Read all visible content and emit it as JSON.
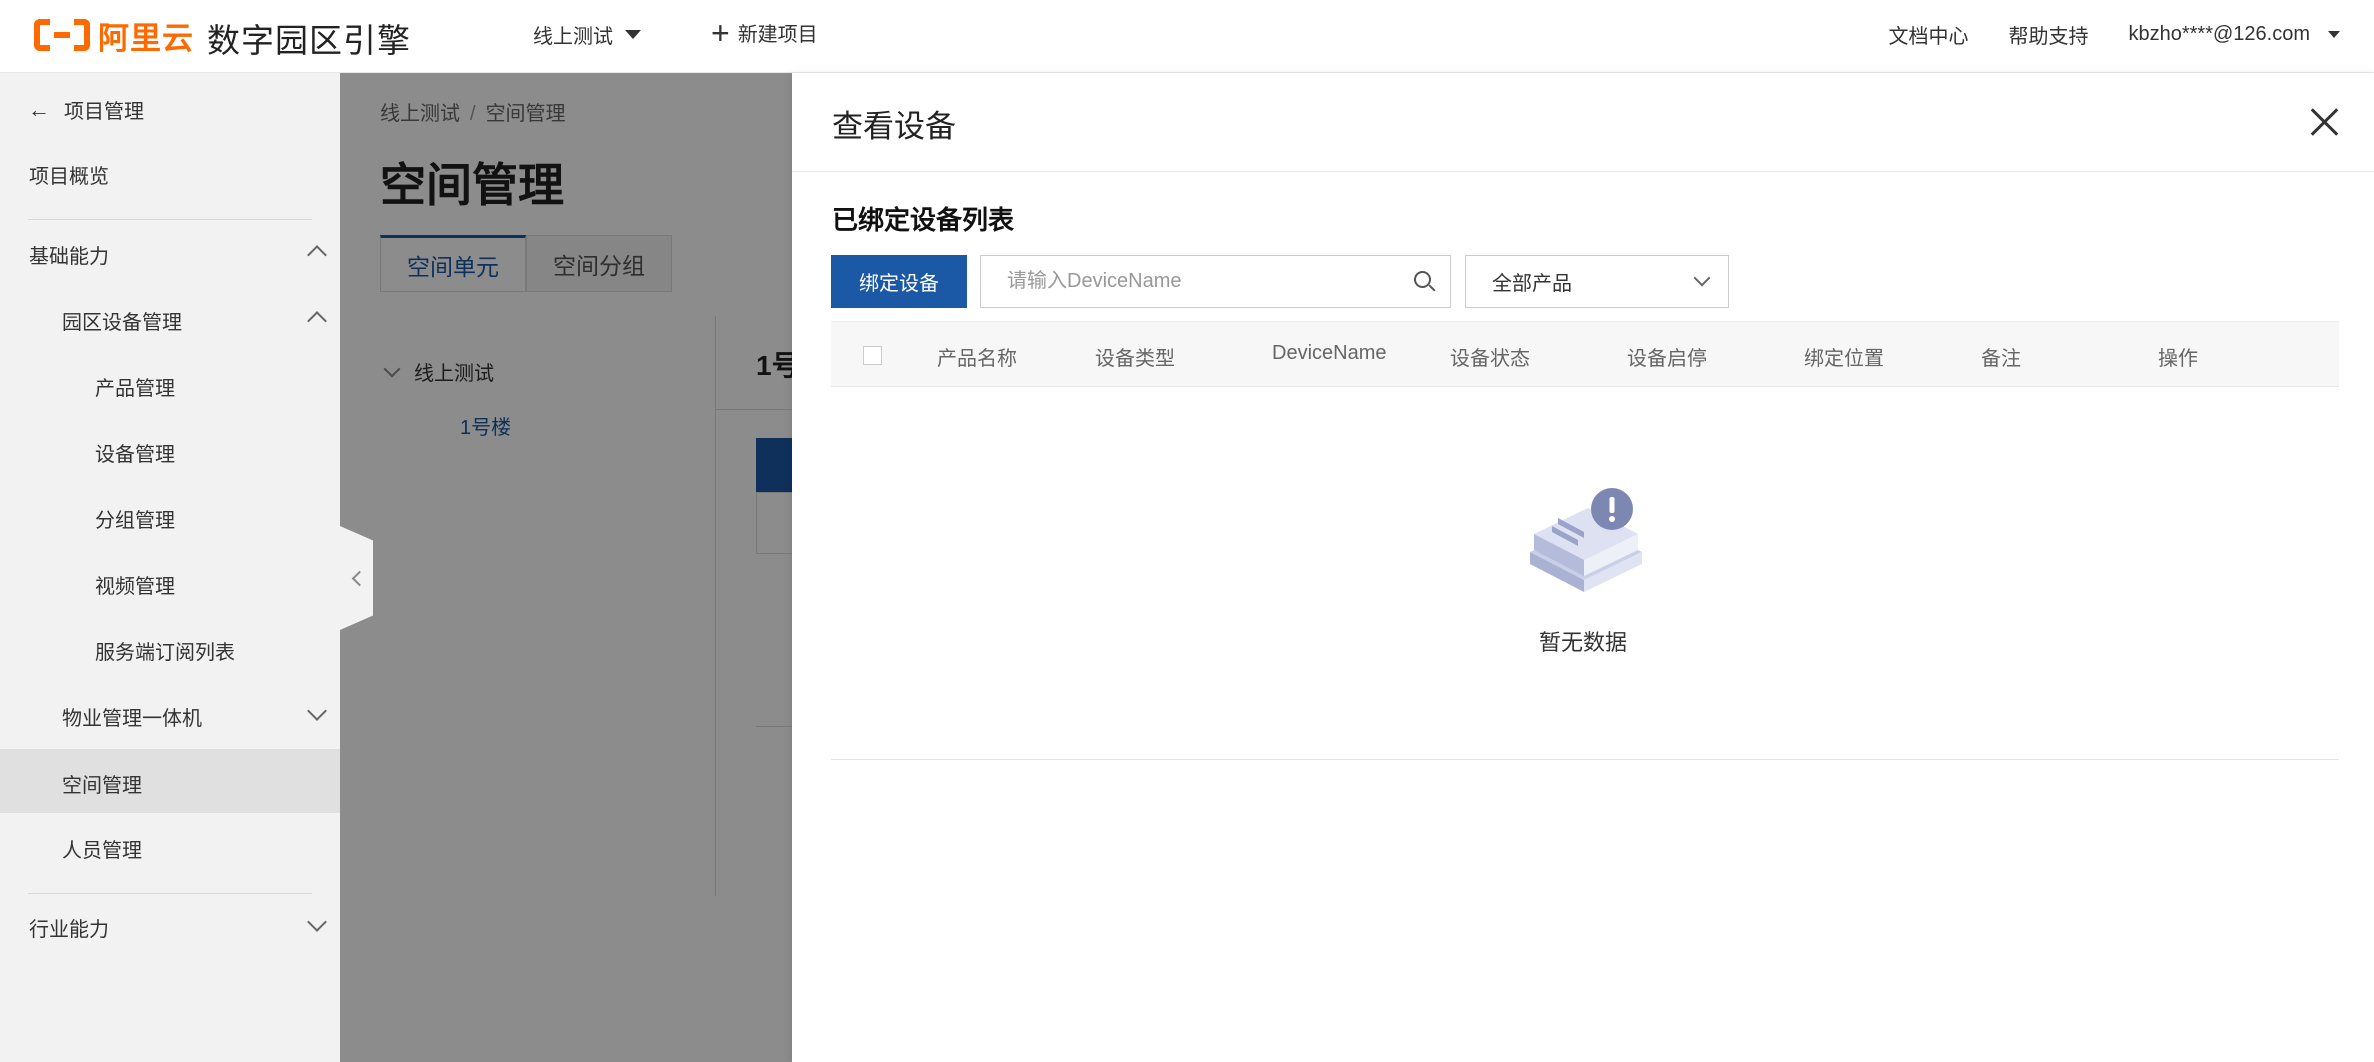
{
  "header": {
    "logo_text": "阿里云",
    "app_title": "数字园区引擎",
    "project_select": "线上测试",
    "new_project": "新建项目",
    "doc_center": "文档中心",
    "help_support": "帮助支持",
    "user": "kbzho****@126.com"
  },
  "sidebar": {
    "back": "项目管理",
    "overview": "项目概览",
    "basic": "基础能力",
    "park_device": "园区设备管理",
    "items": [
      "产品管理",
      "设备管理",
      "分组管理",
      "视频管理",
      "服务端订阅列表"
    ],
    "property": "物业管理一体机",
    "space": "空间管理",
    "people": "人员管理",
    "industry": "行业能力"
  },
  "content": {
    "crumb_1": "线上测试",
    "crumb_sep": "/",
    "crumb_2": "空间管理",
    "title": "空间管理",
    "tabs": [
      "空间单元",
      "空间分组"
    ],
    "tree_root": "线上测试",
    "tree_child": "1号楼",
    "panel_title": "1号"
  },
  "drawer": {
    "title": "查看设备",
    "section_title": "已绑定设备列表",
    "bind_button": "绑定设备",
    "search_placeholder": "请输入DeviceName",
    "product_select": "全部产品",
    "columns": [
      "产品名称",
      "设备类型",
      "DeviceName",
      "设备状态",
      "设备启停",
      "绑定位置",
      "备注",
      "操作"
    ],
    "empty_text": "暂无数据"
  },
  "colors": {
    "brand": "#ff6a00",
    "primary": "#1b58a6"
  }
}
